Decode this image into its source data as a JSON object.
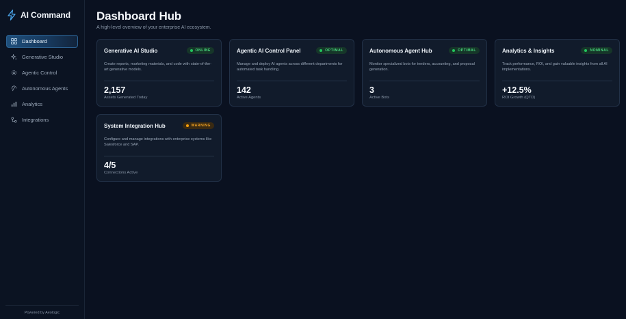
{
  "brand": {
    "title": "AI Command",
    "icon": "lightning-icon"
  },
  "sidebar": {
    "items": [
      {
        "label": "Dashboard",
        "icon": "grid-icon",
        "active": true
      },
      {
        "label": "Generative Studio",
        "icon": "sparkles-icon",
        "active": false
      },
      {
        "label": "Agentic Control",
        "icon": "cog-icon",
        "active": false
      },
      {
        "label": "Autonomous Agents",
        "icon": "bot-icon",
        "active": false
      },
      {
        "label": "Analytics",
        "icon": "bar-chart-icon",
        "active": false
      },
      {
        "label": "Integrations",
        "icon": "link-icon",
        "active": false
      }
    ],
    "footer": "Powered by Aeologic"
  },
  "header": {
    "title": "Dashboard Hub",
    "subtitle": "A high-level overview of your enterprise AI ecosystem."
  },
  "cards": [
    {
      "title": "Generative AI Studio",
      "status": "ONLINE",
      "status_color": "#22c55e",
      "description": "Create reports, marketing materials, and code with state-of-the-art generative models.",
      "metric": "2,157",
      "metric_label": "Assets Generated Today"
    },
    {
      "title": "Agentic AI Control Panel",
      "status": "OPTIMAL",
      "status_color": "#22c55e",
      "description": "Manage and deploy AI agents across different departments for automated task handling.",
      "metric": "142",
      "metric_label": "Active Agents"
    },
    {
      "title": "Autonomous Agent Hub",
      "status": "OPTIMAL",
      "status_color": "#22c55e",
      "description": "Monitor specialized bots for tenders, accounting, and proposal generation.",
      "metric": "3",
      "metric_label": "Active Bots"
    },
    {
      "title": "Analytics & Insights",
      "status": "NOMINAL",
      "status_color": "#22c55e",
      "description": "Track performance, ROI, and gain valuable insights from all AI implementations.",
      "metric": "+12.5%",
      "metric_label": "ROI Growth (QTD)"
    },
    {
      "title": "System Integration Hub",
      "status": "WARNING",
      "status_color": "#f59e0b",
      "description": "Configure and manage integrations with enterprise systems like Salesforce and SAP.",
      "metric": "4/5",
      "metric_label": "Connections Active"
    }
  ],
  "colors": {
    "background": "#0a1120",
    "card": "#111b2b",
    "accent": "#2b6191",
    "ok": "#22c55e",
    "warn": "#f59e0b"
  }
}
